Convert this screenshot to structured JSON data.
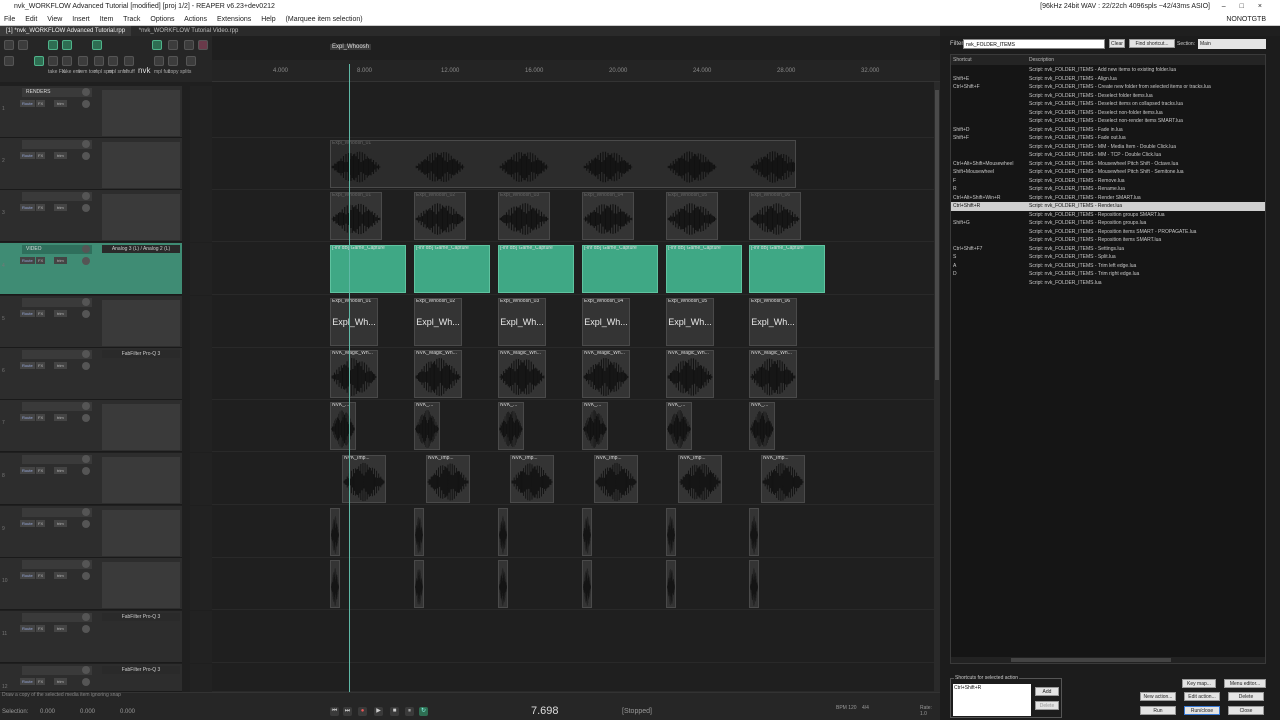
{
  "window": {
    "title": "nvk_WORKFLOW Advanced Tutorial [modified] [proj 1/2] - REAPER v6.23+dev0212",
    "status_right": "[96kHz 24bit WAV : 22/22ch 4096spls ~42/43ms ASIO]"
  },
  "menu": [
    "File",
    "Edit",
    "View",
    "Insert",
    "Item",
    "Track",
    "Options",
    "Actions",
    "Extensions",
    "Help",
    "(Marquee item selection)"
  ],
  "menu_right": "NONOTGTB",
  "tabs": [
    "[1] *nvk_WORKFLOW Advanced Tutorial.rpp",
    "*nvk_WORKFLOW Tutorial Video.rpp"
  ],
  "toolbar": {
    "labels": [
      "take FX",
      "take env",
      "item tool",
      "mpl spot",
      "mpl snfrl",
      "shuff",
      "nvk",
      "mpl full",
      "copy splits"
    ]
  },
  "ruler": {
    "ticks": [
      "4.000",
      "8.000",
      "12.000",
      "16.000",
      "20.000",
      "24.000",
      "28.000",
      "32.000"
    ]
  },
  "marker": "Expl_Whoosh",
  "tracks": [
    {
      "num": "1",
      "name": "RENDERS",
      "fx": "",
      "selected": false
    },
    {
      "num": "2",
      "name": "",
      "fx": "",
      "selected": false
    },
    {
      "num": "3",
      "name": "",
      "fx": "",
      "selected": false
    },
    {
      "num": "4",
      "name": "VIDEO",
      "fx": "Analog 3 (L) / Analog 2 (L)",
      "selected": true
    },
    {
      "num": "5",
      "name": "",
      "fx": "",
      "selected": false
    },
    {
      "num": "6",
      "name": "",
      "fx": "FabFilter Pro-Q 3",
      "selected": false
    },
    {
      "num": "7",
      "name": "",
      "fx": "",
      "selected": false
    },
    {
      "num": "8",
      "name": "",
      "fx": "",
      "selected": false
    },
    {
      "num": "9",
      "name": "",
      "fx": "",
      "selected": false
    },
    {
      "num": "10",
      "name": "",
      "fx": "",
      "selected": false
    },
    {
      "num": "11",
      "name": "",
      "fx": "FabFilter Pro-Q 3",
      "selected": false
    },
    {
      "num": "12",
      "name": "",
      "fx": "FabFilter Pro-Q 3",
      "selected": false
    }
  ],
  "tcp_buttons": {
    "route": "Route",
    "fx": "FX",
    "trim": "trim"
  },
  "lanes": {
    "render_a": {
      "labels": [
        "Expl_Whoosh_01"
      ]
    },
    "render_b": {
      "labels": [
        "Expl_Whoosh_01",
        "Expl_Whoosh_02",
        "Expl_Whoosh_03",
        "Expl_Whoosh_04",
        "Expl_Whoosh_05",
        "Expl_Whoosh_06"
      ]
    },
    "video": {
      "labels": [
        "[-inf dB] Game_Capture",
        "[-inf dB] Game_Capture",
        "[-inf dB] Game_Capture",
        "[-inf dB] Game_Capture",
        "[-inf dB] Game_Capture",
        "[-inf dB] Game_Capture"
      ]
    },
    "folder": {
      "labels": [
        "Expl_Whoosh_01",
        "Expl_Whoosh_02",
        "Expl_Whoosh_03",
        "Expl_Whoosh_04",
        "Expl_Whoosh_05",
        "Expl_Whoosh_06"
      ],
      "big": [
        "Expl_Wh...",
        "Expl_Wh...",
        "Expl_Wh...",
        "Expl_Wh...",
        "Expl_Wh...",
        "Expl_Wh..."
      ]
    },
    "magic": {
      "labels": [
        "NVK_Magic_Wh...",
        "NVK_Magic_Wh...",
        "NVK_Magic_Wh...",
        "NVK_Magic_Wh...",
        "NVK_Magic_Wh...",
        "NVK_Magic_Wh..."
      ]
    },
    "short": {
      "labels": [
        "NVK_...",
        "NVK_...",
        "NVK_...",
        "NVK_...",
        "NVK_...",
        "NVK_..."
      ]
    },
    "imp": {
      "labels": [
        "NVK_Imp...",
        "NVK_Imp...",
        "NVK_Imp...",
        "NVK_Imp...",
        "NVK_Imp...",
        "NVK_Imp..."
      ]
    }
  },
  "transport": {
    "selection_label": "Selection:",
    "sel_start": "0.000",
    "sel_end": "0.000",
    "sel_len": "0.000",
    "position": "7.698",
    "state": "[Stopped]",
    "bpm": "BPM 120",
    "sig": "4/4",
    "rate": "Rate: 1.0"
  },
  "status_hint": "Draw a copy of the selected media item ignoring snap",
  "actions": {
    "filter_label": "Filter:",
    "filter_value": "nvk_FOLDER_ITEMS",
    "clear": "Clear",
    "find": "Find shortcut...",
    "section_label": "Section:",
    "section_value": "Main",
    "col_shortcut": "Shortcut",
    "col_description": "Description",
    "rows": [
      {
        "shortcut": "",
        "desc": "Script: nvk_FOLDER_ITEMS - Add new items to existing folder.lua"
      },
      {
        "shortcut": "Shift+E",
        "desc": "Script: nvk_FOLDER_ITEMS - Align.lua"
      },
      {
        "shortcut": "Ctrl+Shift+F",
        "desc": "Script: nvk_FOLDER_ITEMS - Create new folder from selected items or tracks.lua"
      },
      {
        "shortcut": "",
        "desc": "Script: nvk_FOLDER_ITEMS - Deselect folder items.lua"
      },
      {
        "shortcut": "",
        "desc": "Script: nvk_FOLDER_ITEMS - Deselect items on collapsed tracks.lua"
      },
      {
        "shortcut": "",
        "desc": "Script: nvk_FOLDER_ITEMS - Deselect non-folder items.lua"
      },
      {
        "shortcut": "",
        "desc": "Script: nvk_FOLDER_ITEMS - Deselect non-render items SMART.lua"
      },
      {
        "shortcut": "Shift+D",
        "desc": "Script: nvk_FOLDER_ITEMS - Fade in.lua"
      },
      {
        "shortcut": "Shift+F",
        "desc": "Script: nvk_FOLDER_ITEMS - Fade out.lua"
      },
      {
        "shortcut": "",
        "desc": "Script: nvk_FOLDER_ITEMS - MM - Media Item - Double Click.lua"
      },
      {
        "shortcut": "",
        "desc": "Script: nvk_FOLDER_ITEMS - MM - TCP - Double Click.lua"
      },
      {
        "shortcut": "Ctrl+Alt+Shift+Mousewheel",
        "desc": "Script: nvk_FOLDER_ITEMS - Mousewheel Pitch Shift - Octave.lua"
      },
      {
        "shortcut": "Shift+Mousewheel",
        "desc": "Script: nvk_FOLDER_ITEMS - Mousewheel Pitch Shift - Semitone.lua"
      },
      {
        "shortcut": "F",
        "desc": "Script: nvk_FOLDER_ITEMS - Remove.lua"
      },
      {
        "shortcut": "R",
        "desc": "Script: nvk_FOLDER_ITEMS - Rename.lua"
      },
      {
        "shortcut": "Ctrl+Alt+Shift+Win+R",
        "desc": "Script: nvk_FOLDER_ITEMS - Render SMART.lua"
      },
      {
        "shortcut": "Ctrl+Shift+R",
        "desc": "Script: nvk_FOLDER_ITEMS - Render.lua",
        "hi": true
      },
      {
        "shortcut": "",
        "desc": "Script: nvk_FOLDER_ITEMS - Reposition groups SMART.lua"
      },
      {
        "shortcut": "Shift+G",
        "desc": "Script: nvk_FOLDER_ITEMS - Reposition groups.lua"
      },
      {
        "shortcut": "",
        "desc": "Script: nvk_FOLDER_ITEMS - Reposition items SMART - PROPAGATE.lua"
      },
      {
        "shortcut": "",
        "desc": "Script: nvk_FOLDER_ITEMS - Reposition items SMART.lua"
      },
      {
        "shortcut": "Ctrl+Shift+F7",
        "desc": "Script: nvk_FOLDER_ITEMS - Settings.lua"
      },
      {
        "shortcut": "S",
        "desc": "Script: nvk_FOLDER_ITEMS - Split.lua"
      },
      {
        "shortcut": "A",
        "desc": "Script: nvk_FOLDER_ITEMS - Trim left edge.lua"
      },
      {
        "shortcut": "D",
        "desc": "Script: nvk_FOLDER_ITEMS - Trim right edge.lua"
      },
      {
        "shortcut": "",
        "desc": "Script: nvk_FOLDER_ITEMS.lua"
      }
    ],
    "shortcuts_label": "Shortcuts for selected action",
    "shortcut_value": "Ctrl+Shift+R",
    "add": "Add",
    "delete_sc": "Delete",
    "keymap": "Key map...",
    "menu_editor": "Menu editor...",
    "new_action": "New action...",
    "edit_action": "Edit action...",
    "delete": "Delete",
    "run": "Run",
    "run_close": "Run/close",
    "close": "Close"
  }
}
